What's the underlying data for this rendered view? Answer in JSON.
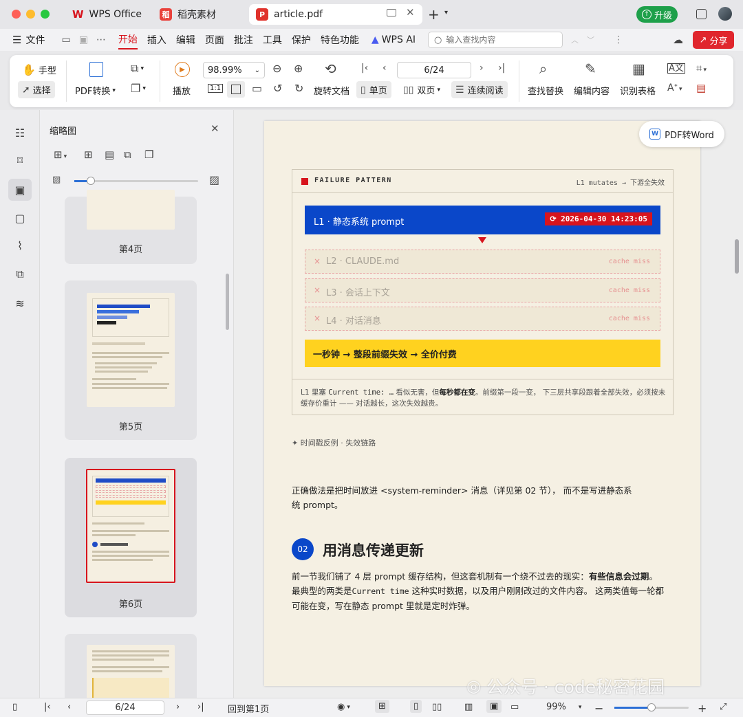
{
  "tabs": [
    {
      "label": "WPS Office",
      "icon": "wps-logo-icon"
    },
    {
      "label": "稻壳素材",
      "icon": "docer-icon"
    },
    {
      "label": "article.pdf",
      "icon": "pdf-icon"
    }
  ],
  "upgrade_label": "升级",
  "menu": [
    "文件",
    "开始",
    "插入",
    "编辑",
    "页面",
    "批注",
    "工具",
    "保护",
    "特色功能",
    "WPS AI"
  ],
  "search_placeholder": "输入查找内容",
  "share_label": "分享",
  "ribbon": {
    "hand": "手型",
    "select": "选择",
    "pdf_convert": "PDF转换",
    "play": "播放",
    "zoom": "98.99%",
    "rotate": "旋转文档",
    "page_box": "6/24",
    "single": "单页",
    "double": "双页",
    "continuous": "连续阅读",
    "find_replace": "查找替换",
    "edit_content": "编辑内容",
    "recognize_table": "识别表格"
  },
  "thumbnails": {
    "title": "缩略图",
    "pages": [
      "第4页",
      "第5页",
      "第6页"
    ]
  },
  "float_button": "PDF转Word",
  "document": {
    "fp_title": "FAILURE PATTERN",
    "fp_right": "L1 mutates → 下游全失效",
    "l1": "L1 · 静态系统 prompt",
    "timestamp": "⟳ 2026-04-30 14:23:05",
    "layers": [
      {
        "mark": "×",
        "label": "L2 · CLAUDE.md",
        "status": "cache miss"
      },
      {
        "mark": "×",
        "label": "L3 · 会话上下文",
        "status": "cache miss"
      },
      {
        "mark": "×",
        "label": "L4 · 对话消息",
        "status": "cache miss"
      }
    ],
    "banner": "一秒钟 → 整段前缀失效 → 全价付费",
    "note_pre": "L1 里塞 ",
    "note_code": "Current time: …",
    "note_mid": " 看似无害，但",
    "note_bold": "每秒都在变",
    "note_rest": "。前缀第一段一变， 下三层共享段跟着全部失效，必须按未",
    "note_line2": "缓存价重计 —— 对话越长，这次失效越贵。",
    "caption": "✦ 时间戳反例 · 失效链路",
    "para1_line1": "正确做法是把时间放进 <system-reminder> 消息（详见第 02 节）， 而不是写进静态系",
    "para1_line2": "统 prompt。",
    "section_num": "02",
    "section_title": "用消息传递更新",
    "para2_line1a": "前一节我们铺了 4 层 prompt 缓存结构，但这套机制有一个绕不过去的现实：",
    "para2_line1b": "有些信息会过期",
    "para2_line1c": "。",
    "para2_line2a": "最典型的两类是",
    "para2_line2_code": "Current time",
    "para2_line2b": " 这种实时数据，以及用户刚刚改过的文件内容。 这两类值每一轮都",
    "para2_line3": "可能在变，写在静态 prompt 里就是定时炸弹。"
  },
  "status": {
    "page": "6/24",
    "back_to_first": "回到第1页",
    "zoom": "99%"
  },
  "watermark": "公众号 · code秘密花园",
  "colors": {
    "accent_red": "#d7141d",
    "blue": "#0a47c9",
    "yellow": "#ffd21f",
    "page_bg": "#f5f0e3",
    "upgrade_green": "#1ea04a"
  }
}
